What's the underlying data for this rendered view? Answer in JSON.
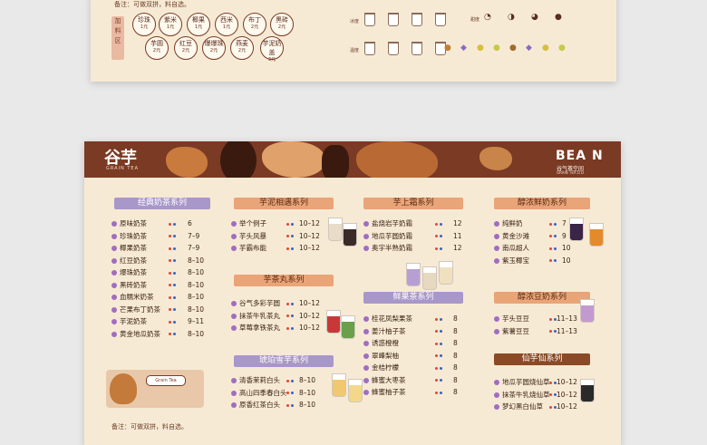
{
  "top_card": {
    "note": "备注：可做双拼，料自选。",
    "tag": [
      "加",
      "料",
      "区"
    ],
    "toppings": [
      {
        "name": "珍珠",
        "price": "1元"
      },
      {
        "name": "紫米",
        "price": "1元"
      },
      {
        "name": "椰果",
        "price": "1元"
      },
      {
        "name": "西米",
        "price": "1元"
      },
      {
        "name": "布丁",
        "price": "2元"
      },
      {
        "name": "黑砖",
        "price": "2元"
      },
      {
        "name": "芋圆",
        "price": "2元"
      },
      {
        "name": "红豆",
        "price": "2元"
      },
      {
        "name": "爆爆珠",
        "price": "2元"
      },
      {
        "name": "燕麦",
        "price": "2元"
      },
      {
        "name": "芋泥奶盖",
        "price": "3元"
      }
    ],
    "legend_labels": [
      "冰度",
      "温度",
      "甜度"
    ]
  },
  "banner": {
    "brand_left": "谷芋",
    "brand_left_sub": "GRAIN TEA",
    "brand_right": "BEA N",
    "brand_right_sub": "谷气茶空间",
    "brand_right_sub2": "GRAIN TEA LTD"
  },
  "colors": {
    "dot_red": "#e2453a",
    "dot_blue": "#3b62c4",
    "banner": "#7a3a24"
  },
  "sections": [
    {
      "title": "经典奶茶系列",
      "style": "purple",
      "items": [
        {
          "name": "原味奶茶",
          "price": "6"
        },
        {
          "name": "珍珠奶茶",
          "price": "7–9"
        },
        {
          "name": "椰果奶茶",
          "price": "7–9"
        },
        {
          "name": "红豆奶茶",
          "price": "8–10"
        },
        {
          "name": "爆珠奶茶",
          "price": "8–10"
        },
        {
          "name": "黑砖奶茶",
          "price": "8–10"
        },
        {
          "name": "血糯米奶茶",
          "price": "8–10"
        },
        {
          "name": "芒果布丁奶茶",
          "price": "8–10"
        },
        {
          "name": "芋泥奶茶",
          "price": "9–11"
        },
        {
          "name": "黄金地瓜奶茶",
          "price": "8–10"
        }
      ]
    },
    {
      "title": "芋泥相遇系列",
      "style": "orange",
      "items": [
        {
          "name": "举个例子",
          "price": "10–12"
        },
        {
          "name": "芋头风暴",
          "price": "10–12"
        },
        {
          "name": "芋霸布能",
          "price": "10–12"
        }
      ]
    },
    {
      "title": "芋茶丸系列",
      "style": "orange",
      "items": [
        {
          "name": "谷气多彩芋圆",
          "price": "10–12"
        },
        {
          "name": "抹茶牛乳茶丸",
          "price": "10–12"
        },
        {
          "name": "草莓拿铁茶丸",
          "price": "10–12"
        }
      ]
    },
    {
      "title": "琥珀雪芋系列",
      "style": "purple",
      "items": [
        {
          "name": "清香茉莉白头",
          "price": "8–10"
        },
        {
          "name": "高山四季春白头",
          "price": "8–10"
        },
        {
          "name": "原香红茶白头",
          "price": "8–10"
        }
      ]
    },
    {
      "title": "芋上霜系列",
      "style": "orange",
      "items": [
        {
          "name": "盐烧岩芋奶霜",
          "price": "12"
        },
        {
          "name": "地瓜芋圆奶霜",
          "price": "11"
        },
        {
          "name": "奥宇半熟奶霜",
          "price": "12"
        }
      ]
    },
    {
      "title": "鲜果茶系列",
      "style": "purple",
      "items": [
        {
          "name": "桂花凤梨果茶",
          "price": "8"
        },
        {
          "name": "姜汁柚子茶",
          "price": "8"
        },
        {
          "name": "诱惑橙橙",
          "price": "8"
        },
        {
          "name": "翠峰梨柚",
          "price": "8"
        },
        {
          "name": "金桔柠檬",
          "price": "8"
        },
        {
          "name": "蜂蜜大枣茶",
          "price": "8"
        },
        {
          "name": "蜂蜜柚子茶",
          "price": "8"
        }
      ]
    },
    {
      "title": "醇浓鲜奶系列",
      "style": "orange",
      "items": [
        {
          "name": "纯鲜奶",
          "price": "7"
        },
        {
          "name": "黄金沙滩",
          "price": "9"
        },
        {
          "name": "南瓜超人",
          "price": "10"
        },
        {
          "name": "紫玉椰宝",
          "price": "10"
        }
      ]
    },
    {
      "title": "醇浓豆奶系列",
      "style": "orange",
      "items": [
        {
          "name": "芋头豆豆",
          "price": "11–13"
        },
        {
          "name": "紫薯豆豆",
          "price": "11–13"
        }
      ]
    },
    {
      "title": "仙芋仙系列",
      "style": "brown",
      "items": [
        {
          "name": "地瓜芋圆烧仙草",
          "price": "10–12"
        },
        {
          "name": "抹茶牛乳烧仙草",
          "price": "10–12"
        },
        {
          "name": "梦幻黑白仙草",
          "price": "10–12"
        }
      ]
    }
  ],
  "mascot_label": "Grain Tea",
  "bottom_note": "备注：可做双拼，料自选。"
}
